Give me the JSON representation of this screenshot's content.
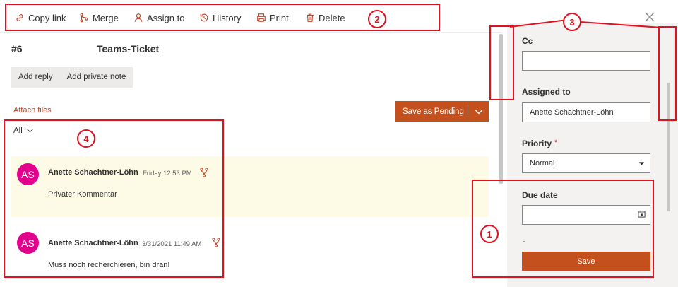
{
  "toolbar": {
    "copy_link": "Copy link",
    "merge": "Merge",
    "assign_to": "Assign to",
    "history": "History",
    "print": "Print",
    "delete": "Delete"
  },
  "ticket": {
    "number": "#6",
    "title": "Teams-Ticket"
  },
  "actions": {
    "add_reply": "Add reply",
    "add_private_note": "Add private note",
    "attach_files": "Attach files",
    "save_as_pending": "Save as Pending"
  },
  "filter": {
    "selected": "All"
  },
  "comments": [
    {
      "initials": "AS",
      "author": "Anette Schachtner-Löhn",
      "date": "Friday 12:53 PM",
      "body": "Privater Kommentar",
      "private": true
    },
    {
      "initials": "AS",
      "author": "Anette Schachtner-Löhn",
      "date": "3/31/2021 11:49 AM",
      "body": "Muss noch recherchieren, bin dran!",
      "private": false
    }
  ],
  "sidepanel": {
    "cc_label": "Cc",
    "cc_value": "",
    "assigned_label": "Assigned to",
    "assigned_value": "Anette Schachtner-Löhn",
    "priority_label": "Priority",
    "priority_required": "*",
    "priority_value": "Normal",
    "due_label": "Due date",
    "due_value": "",
    "dash": "-",
    "save": "Save"
  },
  "annotations": {
    "one": "1",
    "two": "2",
    "three": "3",
    "four": "4"
  },
  "colors": {
    "accent": "#c4501e",
    "annotation": "#e3101f",
    "avatar": "#e3008c",
    "private_note_bg": "#fdfbe6"
  }
}
